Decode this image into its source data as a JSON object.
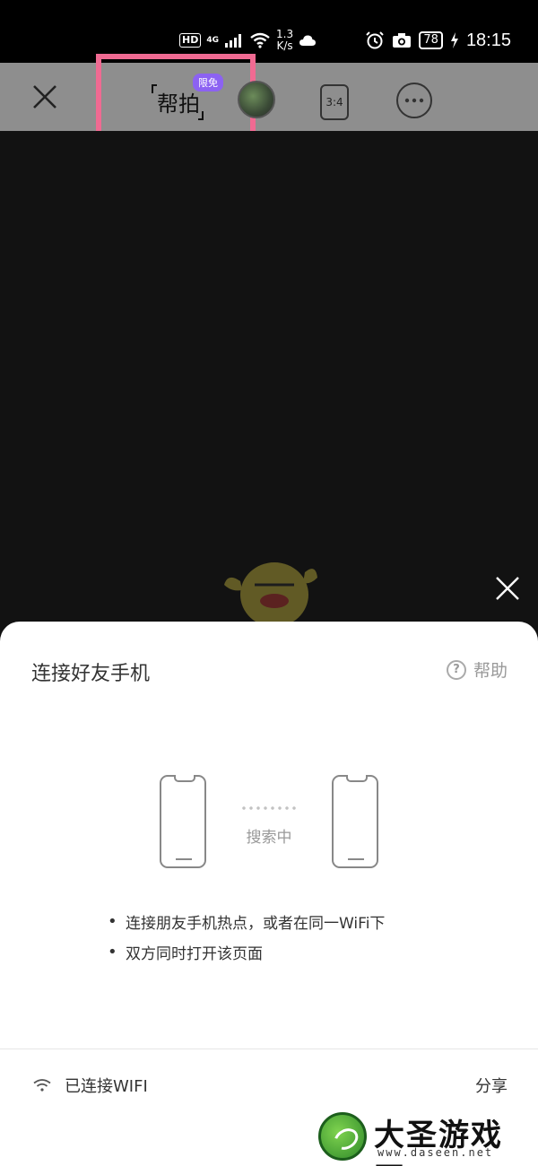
{
  "status_bar": {
    "hd": "HD",
    "network": "4G",
    "speed_value": "1.3",
    "speed_unit": "K/s",
    "battery": "78",
    "time": "18:15"
  },
  "toolbar": {
    "mode_label": "帮拍",
    "badge": "限免",
    "ratio": "3:4",
    "icons": [
      "close-icon",
      "avatar",
      "aspect-ratio-icon",
      "more-icon",
      "switch-camera-icon"
    ]
  },
  "sheet": {
    "title": "连接好友手机",
    "help_label": "帮助",
    "searching": "搜索中",
    "tips": [
      "连接朋友手机热点，或者在同一WiFi下",
      "双方同时打开该页面"
    ],
    "wifi_status": "已连接WIFI",
    "share_label": "分享"
  },
  "watermark": {
    "title": "大圣游戏网",
    "url": "www.daseen.net"
  },
  "colors": {
    "toolbar_bg": "#8e8e8e",
    "badge_bg": "#8c62f2",
    "highlight": "#f06a92"
  }
}
